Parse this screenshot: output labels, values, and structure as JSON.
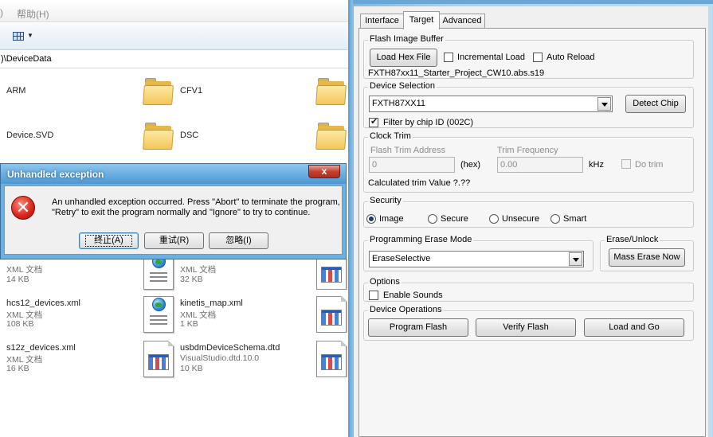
{
  "explorer": {
    "menu_lead": ")",
    "menu_help": "帮助(H)",
    "address": ")\\DeviceData",
    "items": [
      {
        "name": "ARM"
      },
      {
        "name": "CFV1"
      },
      {
        "name": "Device.SVD"
      },
      {
        "name": "DSC"
      },
      {
        "name": "",
        "type": "XML 文档",
        "size": "14 KB"
      },
      {
        "name": "",
        "type": "XML 文档",
        "size": "32 KB"
      },
      {
        "name": "hcs12_devices.xml",
        "type": "XML 文档",
        "size": "108 KB"
      },
      {
        "name": "kinetis_map.xml",
        "type": "XML 文档",
        "size": "1 KB"
      },
      {
        "name": "s12z_devices.xml",
        "type": "XML 文档",
        "size": "16 KB"
      },
      {
        "name": "usbdmDeviceSchema.dtd",
        "type": "VisualStudio.dtd.10.0",
        "size": "10 KB"
      }
    ]
  },
  "dialog": {
    "title": "Unhandled exception",
    "close_label": "x",
    "message": "An unhandled exception occurred. Press \"Abort\" to terminate the program, \"Retry\" to exit the program normally and \"Ignore\" to try to continue.",
    "abort_label": "终止(A)",
    "retry_label": "重试(R)",
    "ignore_label": "忽略(I)"
  },
  "usbdm": {
    "tabs": [
      "Interface",
      "Target",
      "Advanced"
    ],
    "active_tab": "Target",
    "flash_image": {
      "legend": "Flash Image Buffer",
      "load_hex_label": "Load Hex File",
      "incremental_load_label": "Incremental Load",
      "auto_reload_label": "Auto Reload",
      "filename": "FXTH87xx11_Starter_Project_CW10.abs.s19"
    },
    "device_selection": {
      "legend": "Device Selection",
      "selected_device": "FXTH87XX11",
      "detect_chip_label": "Detect Chip",
      "filter_label": "Filter by chip ID (002C)"
    },
    "clock_trim": {
      "legend": "Clock Trim",
      "flash_trim_label": "Flash Trim Address",
      "flash_trim_value": "0",
      "hex_label": "(hex)",
      "trim_freq_label": "Trim Frequency",
      "trim_freq_value": "0.00",
      "khz_label": "kHz",
      "do_trim_label": "Do trim",
      "calculated_label": "Calculated trim Value ?.??"
    },
    "security": {
      "legend": "Security",
      "options": [
        "Image",
        "Secure",
        "Unsecure",
        "Smart"
      ],
      "selected": "Image"
    },
    "erase": {
      "legend": "Programming Erase Mode",
      "value": "EraseSelective",
      "unlock_legend": "Erase/Unlock",
      "mass_erase_label": "Mass Erase Now"
    },
    "options": {
      "legend": "Options",
      "enable_sounds_label": "Enable Sounds"
    },
    "operations": {
      "legend": "Device Operations",
      "program_label": "Program Flash",
      "verify_label": "Verify Flash",
      "load_go_label": "Load and Go"
    }
  }
}
